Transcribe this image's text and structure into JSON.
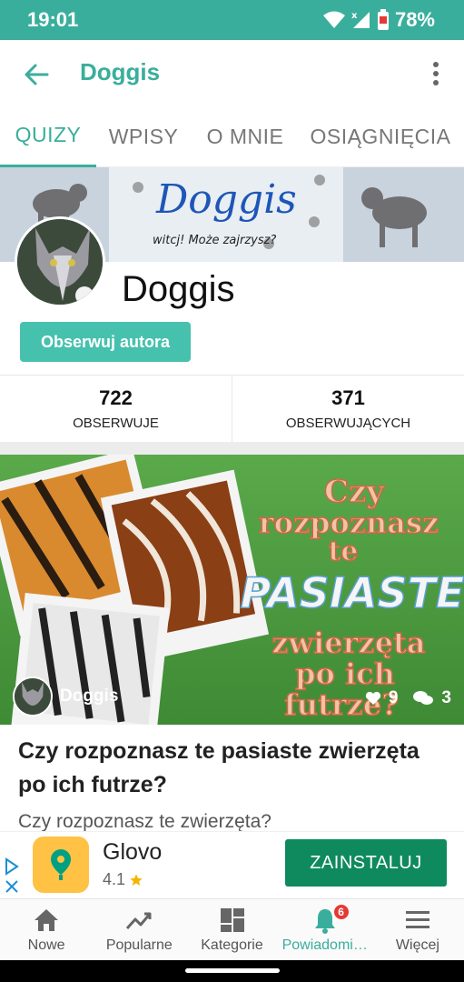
{
  "status_bar": {
    "time": "19:01",
    "battery": "78%"
  },
  "app_bar": {
    "title": "Doggis"
  },
  "tabs": [
    {
      "label": "QUIZY",
      "active": true
    },
    {
      "label": "WPISY",
      "active": false
    },
    {
      "label": "O MNIE",
      "active": false
    },
    {
      "label": "OSIĄGNIĘCIA",
      "active": false
    }
  ],
  "profile": {
    "banner_title": "Doggis",
    "banner_subtitle": "witcj! Może zajrzysz?",
    "name": "Doggis",
    "follow_label": "Obserwuj autora",
    "stats": [
      {
        "value": "722",
        "label": "OBSERWUJE"
      },
      {
        "value": "371",
        "label": "OBSERWUJĄCYCH"
      }
    ]
  },
  "quiz_card": {
    "image_lines": [
      "Czy",
      "rozpoznasz",
      "te",
      "PASIASTE",
      "zwierzęta",
      "po ich",
      "futrze?"
    ],
    "author": "Doggis",
    "likes": "9",
    "comments": "3",
    "title": "Czy rozpoznasz te pasiaste zwierzęta po ich futrze?",
    "description": "Czy rozpoznasz te zwierzęta?"
  },
  "ad": {
    "name": "Glovo",
    "rating": "4.1",
    "button": "ZAINSTALUJ"
  },
  "bottom_nav": [
    {
      "label": "Nowe",
      "icon": "home-icon",
      "active": false
    },
    {
      "label": "Popularne",
      "icon": "trending-icon",
      "active": false
    },
    {
      "label": "Kategorie",
      "icon": "grid-icon",
      "active": false
    },
    {
      "label": "Powiadomi…",
      "icon": "bell-icon",
      "active": true,
      "badge": "6"
    },
    {
      "label": "Więcej",
      "icon": "menu-icon",
      "active": false
    }
  ],
  "colors": {
    "accent": "#3aae9c",
    "ad_button": "#0f8a5f",
    "badge": "#e53935"
  }
}
